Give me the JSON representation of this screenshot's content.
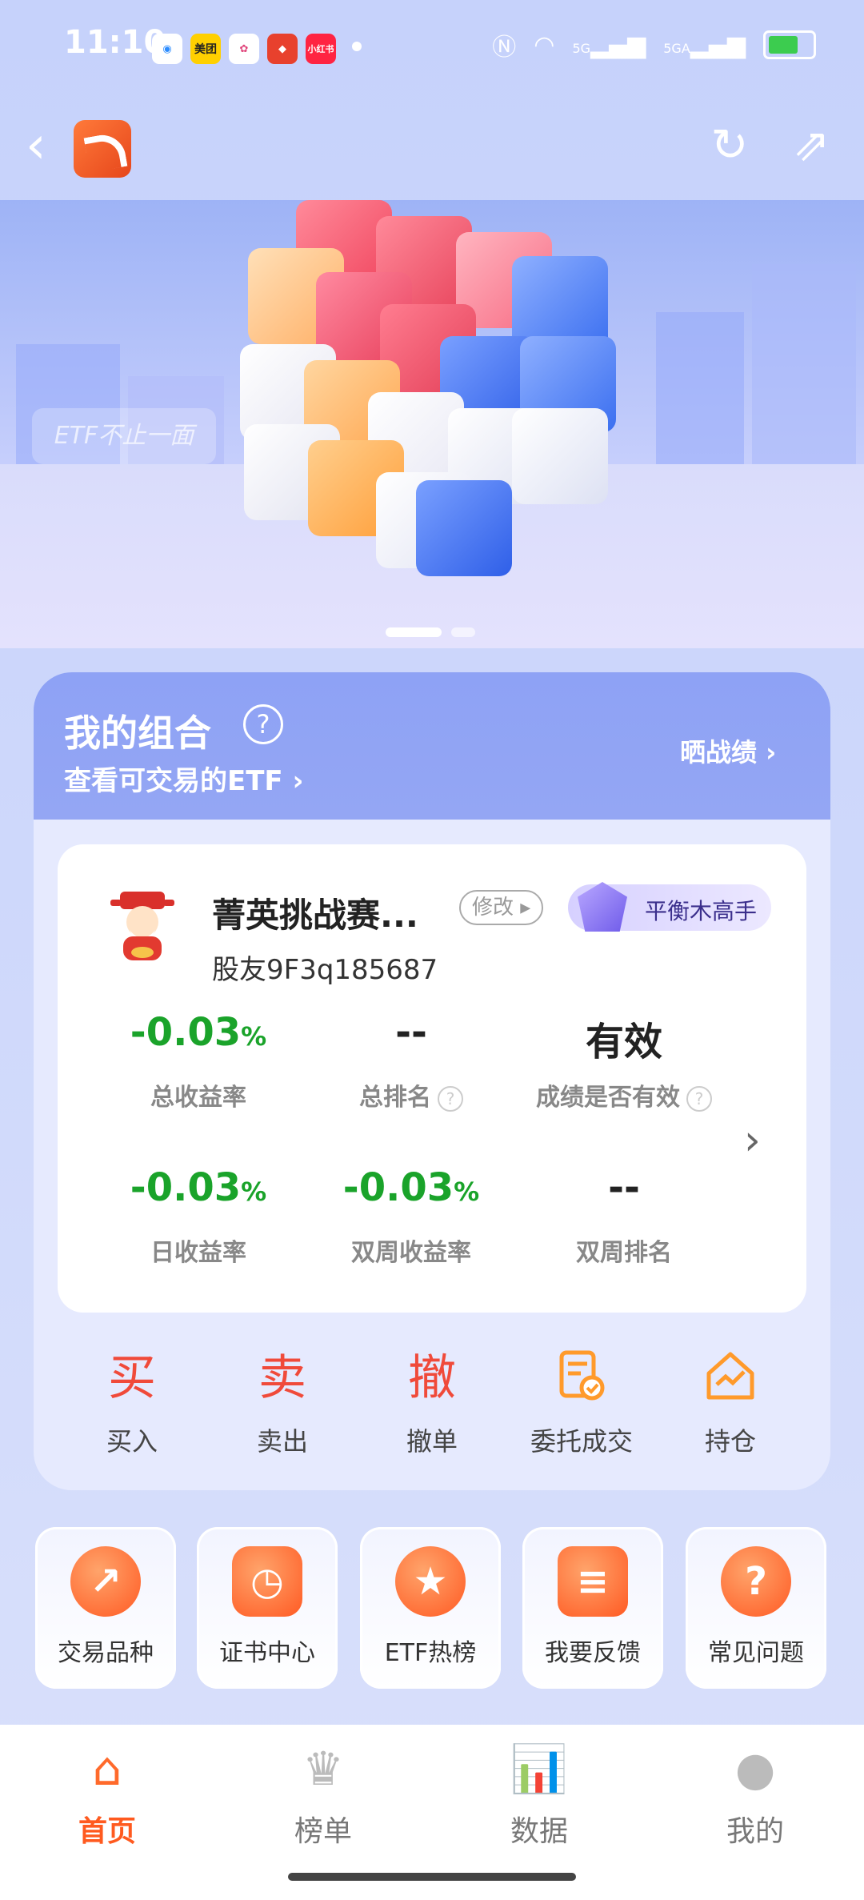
{
  "status_bar": {
    "time": "11:10",
    "app_icons": [
      "qq-icon",
      "meituan-icon",
      "photos-icon",
      "bank-icon",
      "xiaohongshu-icon"
    ],
    "meituan_label": "美团",
    "xhs_label": "小红书",
    "network_labels": [
      "5G",
      "5GA"
    ]
  },
  "header": {
    "back_icon": "back-arrow-icon",
    "refresh_icon": "refresh-icon",
    "share_icon": "share-icon"
  },
  "banner": {
    "watermark": "ETF不止一面",
    "page_count": 2,
    "active_page": 0
  },
  "portfolio": {
    "title": "我的组合",
    "tradable_link": "查看可交易的ETF",
    "show_results": "晒战绩",
    "name": "菁英挑战赛...",
    "edit_label": "修改",
    "badge_label": "平衡木高手",
    "user_id": "股友9F3q185687",
    "stats": [
      {
        "value": "-0.03",
        "unit": "%",
        "label": "总收益率",
        "help": false
      },
      {
        "value": "--",
        "unit": "",
        "label": "总排名",
        "help": true
      },
      {
        "value": "有效",
        "unit": "",
        "label": "成绩是否有效",
        "help": true
      },
      {
        "value": "-0.03",
        "unit": "%",
        "label": "日收益率",
        "help": false
      },
      {
        "value": "-0.03",
        "unit": "%",
        "label": "双周收益率",
        "help": false
      },
      {
        "value": "--",
        "unit": "",
        "label": "双周排名",
        "help": false
      }
    ]
  },
  "actions": [
    {
      "glyph": "买",
      "label": "买入"
    },
    {
      "glyph": "卖",
      "label": "卖出"
    },
    {
      "glyph": "撤",
      "label": "撤单"
    },
    {
      "glyph": "",
      "label": "委托成交"
    },
    {
      "glyph": "",
      "label": "持仓"
    }
  ],
  "tiles": [
    {
      "label": "交易品种",
      "icon": "trend-search-icon"
    },
    {
      "label": "证书中心",
      "icon": "clock-icon"
    },
    {
      "label": "ETF热榜",
      "icon": "medal-icon"
    },
    {
      "label": "我要反馈",
      "icon": "feedback-icon"
    },
    {
      "label": "常见问题",
      "icon": "question-icon"
    }
  ],
  "nav": [
    {
      "label": "首页",
      "active": true
    },
    {
      "label": "榜单",
      "active": false
    },
    {
      "label": "数据",
      "active": false
    },
    {
      "label": "我的",
      "active": false
    }
  ],
  "colors": {
    "accent": "#ff5a1f",
    "gain_green": "#1aa32a",
    "card_header": "#8ea2f5"
  }
}
